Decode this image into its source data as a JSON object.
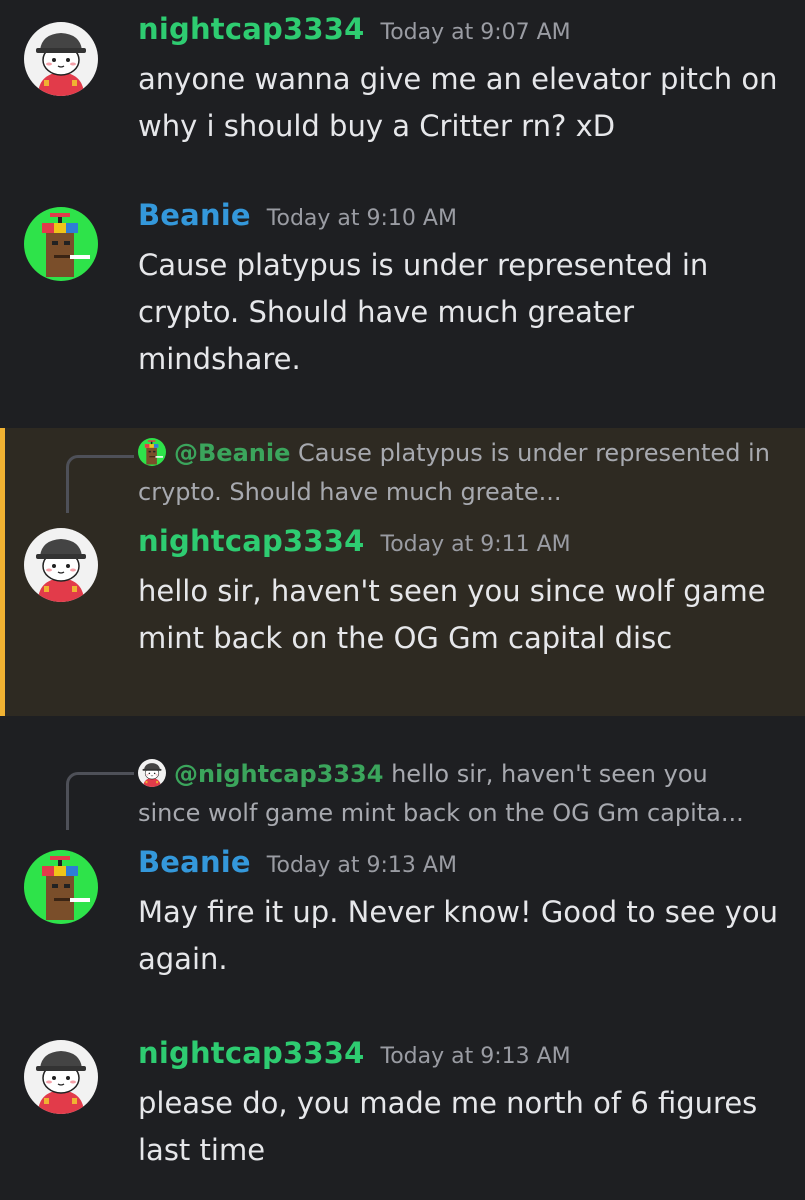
{
  "messages": [
    {
      "author": "nightcap3334",
      "author_color": "#2ecc71",
      "time": "Today at 9:07 AM",
      "text": "anyone wanna give me an elevator pitch on why i should buy a Critter rn? xD"
    },
    {
      "author": "Beanie",
      "author_color": "#3498db",
      "time": "Today at 9:10 AM",
      "text": "Cause platypus is under represented in crypto. Should have much greater mindshare."
    },
    {
      "author": "nightcap3334",
      "author_color": "#2ecc71",
      "time": "Today at 9:11 AM",
      "text": "hello sir, haven't seen you since wolf game mint back on the OG Gm capital disc",
      "reply": {
        "mention": "@Beanie",
        "snippet": "Cause platypus is under represented in crypto. Should have much greate..."
      },
      "highlighted": true
    },
    {
      "author": "Beanie",
      "author_color": "#3498db",
      "time": "Today at 9:13 AM",
      "text": "May fire it up. Never know! Good to see you again.",
      "reply": {
        "mention": "@nightcap3334",
        "snippet": "hello sir, haven't seen you since wolf game mint back on the OG Gm capita..."
      }
    },
    {
      "author": "nightcap3334",
      "author_color": "#2ecc71",
      "time": "Today at 9:13 AM",
      "text": "please do, you made me north of 6 figures last time"
    }
  ],
  "colors": {
    "background": "#1e1f22",
    "highlight_background": "#2e2a22",
    "highlight_border": "#f0b232"
  }
}
